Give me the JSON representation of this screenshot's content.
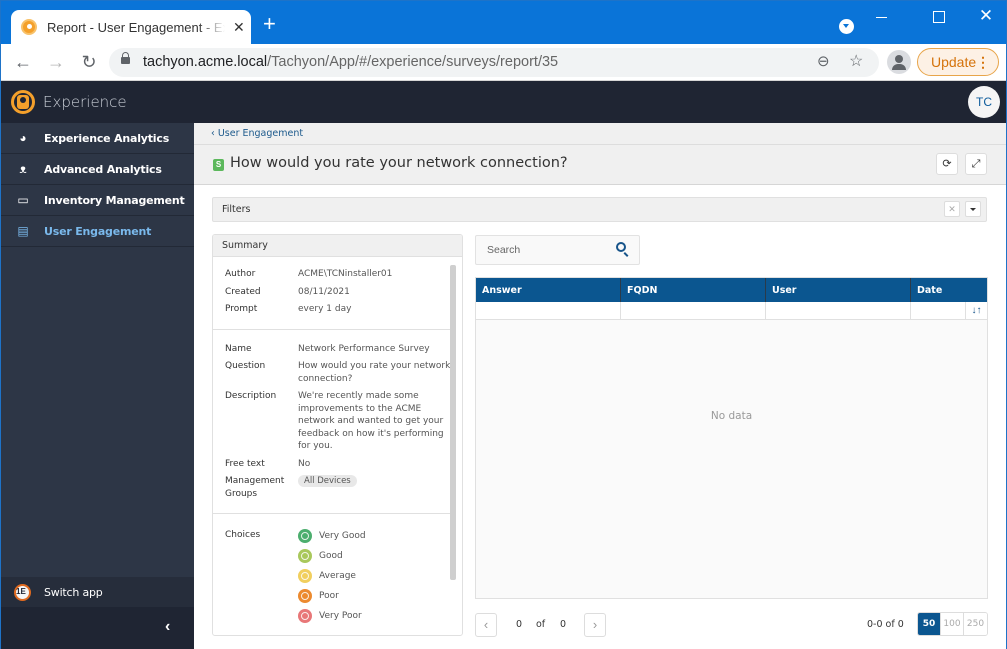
{
  "browser": {
    "tab_title": "Report - User Engagement - Experience",
    "url_host": "tachyon.acme.local",
    "url_path": "/Tachyon/App/#/experience/surveys/report/35",
    "update_label": "Update"
  },
  "app": {
    "title": "Experience",
    "user_initials": "TC"
  },
  "sidebar": {
    "items": [
      {
        "label": "Experience Analytics",
        "icon": "dashboard-icon"
      },
      {
        "label": "Advanced Analytics",
        "icon": "binoculars-icon"
      },
      {
        "label": "Inventory Management",
        "icon": "monitor-icon"
      },
      {
        "label": "User Engagement",
        "icon": "clipboard-icon",
        "active": true
      }
    ],
    "switch_app": "Switch app"
  },
  "page": {
    "breadcrumb": "User Engagement",
    "badge": "S",
    "title": "How would you rate your network connection?",
    "filters_label": "Filters"
  },
  "summary": {
    "header": "Summary",
    "author_label": "Author",
    "author": "ACME\\TCNinstaller01",
    "created_label": "Created",
    "created": "08/11/2021",
    "prompt_label": "Prompt",
    "prompt": "every 1 day",
    "name_label": "Name",
    "name": "Network Performance Survey",
    "question_label": "Question",
    "question": "How would you rate your network connection?",
    "description_label": "Description",
    "description": "We're recently made some improvements to the ACME network and wanted to get your feedback on how it's performing for you.",
    "free_text_label": "Free text",
    "free_text": "No",
    "groups_label": "Management Groups",
    "groups": "All Devices",
    "choices_label": "Choices",
    "choices": [
      {
        "label": "Very Good",
        "color": "#4cae6e"
      },
      {
        "label": "Good",
        "color": "#a9c85c"
      },
      {
        "label": "Average",
        "color": "#f1cf5e"
      },
      {
        "label": "Poor",
        "color": "#ec8a2f"
      },
      {
        "label": "Very Poor",
        "color": "#e87778"
      }
    ]
  },
  "grid": {
    "search_placeholder": "Search",
    "columns": [
      "Answer",
      "FQDN",
      "User",
      "Date"
    ],
    "empty_text": "No data",
    "page_current": "0",
    "page_of": "of",
    "page_total": "0",
    "range_text": "0-0 of 0",
    "page_sizes": [
      "50",
      "100",
      "250"
    ],
    "active_page_size": "50"
  }
}
